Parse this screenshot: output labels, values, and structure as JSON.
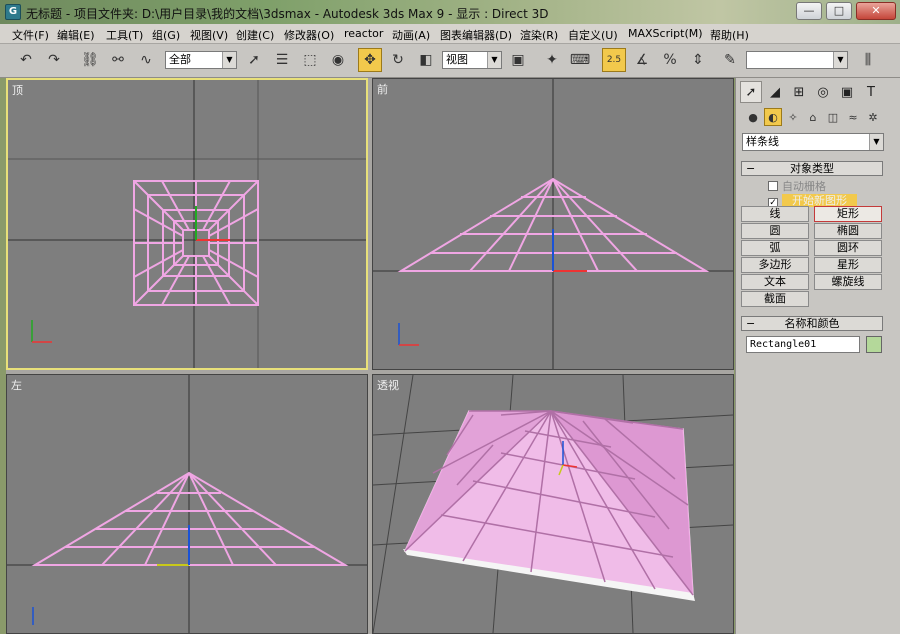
{
  "titlebar": {
    "app_icon": "G",
    "title": "无标题     - 项目文件夹: D:\\用户目录\\我的文档\\3dsmax     - Autodesk 3ds Max 9     - 显示 : Direct 3D",
    "minimize": "—",
    "maximize": "□",
    "close": "✕"
  },
  "menubar": {
    "items": [
      "文件(F)",
      "编辑(E)",
      "工具(T)",
      "组(G)",
      "视图(V)",
      "创建(C)",
      "修改器(O)",
      "reactor",
      "动画(A)",
      "图表编辑器(D)",
      "渲染(R)",
      "自定义(U)",
      "MAXScript(M)",
      "帮助(H)"
    ]
  },
  "toolbar": {
    "selection_filter": "全部",
    "ref_coord": "视图",
    "snap_value": "2.5",
    "named_sel": ""
  },
  "viewports": {
    "top": "顶",
    "front": "前",
    "left": "左",
    "perspective": "透视"
  },
  "panel": {
    "category": "样条线",
    "object_type_title": "对象类型",
    "auto_grid": "自动栅格",
    "start_new_shape": "开始新图形",
    "buttons": [
      "线",
      "矩形",
      "圆",
      "椭圆",
      "弧",
      "圆环",
      "多边形",
      "星形",
      "文本",
      "螺旋线",
      "截面"
    ],
    "name_color_title": "名称和颜色",
    "object_name": "Rectangle01",
    "object_color": "#b4d89a"
  },
  "colors": {
    "wire": "#f0a6e4",
    "active_border": "#e8e07a",
    "viewport_bg": "#7e7e7e"
  }
}
